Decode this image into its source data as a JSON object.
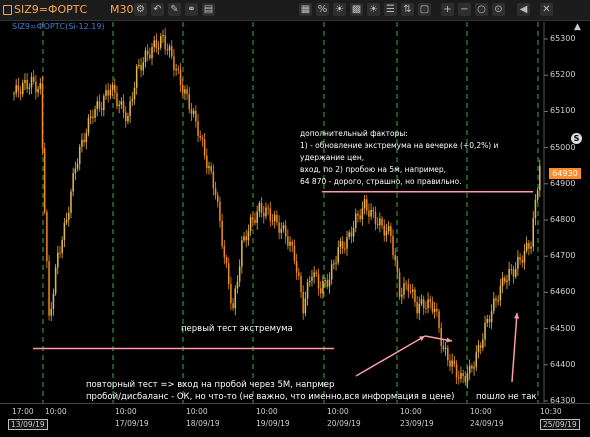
{
  "toolbar": {
    "ticker": "SIZ9=ФОРТС",
    "timeframe": "M30",
    "icons": [
      "settings-icon",
      "undo-icon",
      "brush-icon",
      "link-icon",
      "layers-icon",
      "grid-icon",
      "percent-icon",
      "sun-icon",
      "bars-icon",
      "sun-icon",
      "menu-icon",
      "compare-icon",
      "zoom-in-icon",
      "zoom-out-icon",
      "zoom-reset-icon",
      "zoom-fit-icon",
      "scroll-left-icon",
      "close-icon"
    ]
  },
  "subtitle": "SIZ9=ФОРТС(Si-12.19)",
  "annotations": {
    "note_lines": [
      "дополнительный факторы:",
      "1) - обновление экстремума на вечерке (+0,2%) и",
      "удержание цен,",
      "вход, по 2) пробою на 5м, например,",
      "64 870 - дорого, страшно, но правильно."
    ],
    "first_test": "первый тест экстремума",
    "second_test_lines": [
      "повторный тест => вход на пробой через 5М, напрмер",
      "пробой/дисбаланс - ОК, но что-то (не важно, что именно,вся информация в цене)"
    ],
    "went_wrong": "пошло не так"
  },
  "y_axis": {
    "ticks": [
      "65300",
      "65200",
      "65100",
      "65000",
      "64900",
      "64800",
      "64700",
      "64600",
      "64500",
      "64400",
      "64300"
    ],
    "current_price": "64930",
    "badge": "S"
  },
  "x_axis": {
    "time_labels": [
      "17:00",
      "10:00",
      "10:00",
      "10:00",
      "10:00",
      "10:00",
      "10:00",
      "10:00",
      "10:30"
    ],
    "date_labels": [
      "13/09/19",
      "17/09/19",
      "18/09/19",
      "19/09/19",
      "20/09/19",
      "23/09/19",
      "24/09/19",
      "25/09/19"
    ]
  },
  "colors": {
    "accent": "#ffa64d",
    "bull": "#e3b84a",
    "bear": "#f08a1c",
    "session": "#3fae3f",
    "annotation_line": "#ff9aa8",
    "background": "#000000"
  },
  "chart_data": {
    "type": "candlestick",
    "title": "SIZ9=ФОРТС(Si-12.19)",
    "timeframe": "M30",
    "ylim": [
      64300,
      65330
    ],
    "level_lines": [
      64878,
      64445
    ],
    "close_series_approx": [
      65150,
      65170,
      65180,
      65160,
      64520,
      64700,
      64800,
      64950,
      65030,
      65100,
      65120,
      65170,
      65120,
      65080,
      65210,
      65250,
      65280,
      65300,
      65250,
      65180,
      65120,
      65050,
      64960,
      64880,
      64700,
      64550,
      64730,
      64790,
      64830,
      64820,
      64790,
      64760,
      64700,
      64560,
      64660,
      64610,
      64640,
      64720,
      64740,
      64800,
      64840,
      64810,
      64780,
      64760,
      64600,
      64620,
      64560,
      64570,
      64560,
      64440,
      64400,
      64360,
      64380,
      64440,
      64520,
      64580,
      64640,
      64660,
      64700,
      64740,
      64950
    ]
  }
}
